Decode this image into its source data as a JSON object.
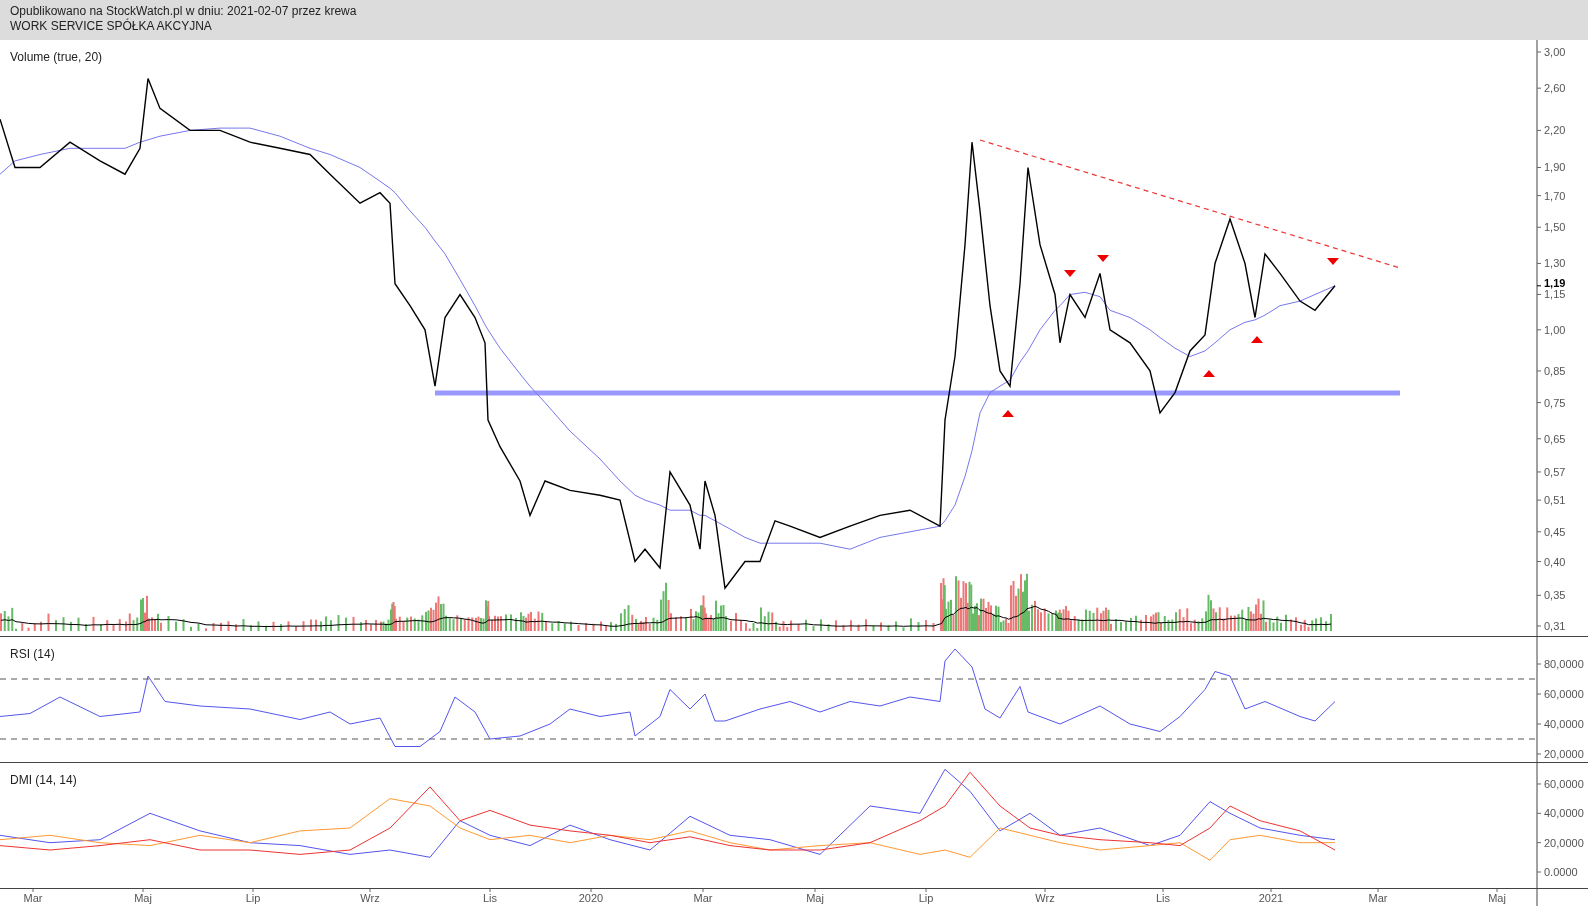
{
  "header": {
    "published": "Opublikowano na StockWatch.pl w dniu: 2021-02-07 przez krewa",
    "company": "WORK SERVICE SPÓŁKA AKCYJNA"
  },
  "panels": [
    {
      "title": "Volume (true, 20)",
      "last_price_label": "1,19",
      "y_axis_labels": [
        "3,00",
        "2,60",
        "2,20",
        "1,90",
        "1,70",
        "1,50",
        "1,30",
        "1,15",
        "1,00",
        "0,85",
        "0,75",
        "0,65",
        "0,57",
        "0,51",
        "0,45",
        "0,40",
        "0,35",
        "0,31"
      ]
    },
    {
      "title": "RSI (14)",
      "y_axis_labels": [
        "80,0000",
        "60,0000",
        "40,0000",
        "20,0000"
      ]
    },
    {
      "title": "DMI (14, 14)",
      "y_axis_labels": [
        "60,0000",
        "40,0000",
        "20,0000",
        "0.0000"
      ]
    }
  ],
  "x_axis_labels": [
    "Mar",
    "Maj",
    "Lip",
    "Wrz",
    "Lis",
    "2020",
    "Mar",
    "Maj",
    "Lip",
    "Wrz",
    "Lis",
    "2021",
    "Mar",
    "Maj"
  ]
}
